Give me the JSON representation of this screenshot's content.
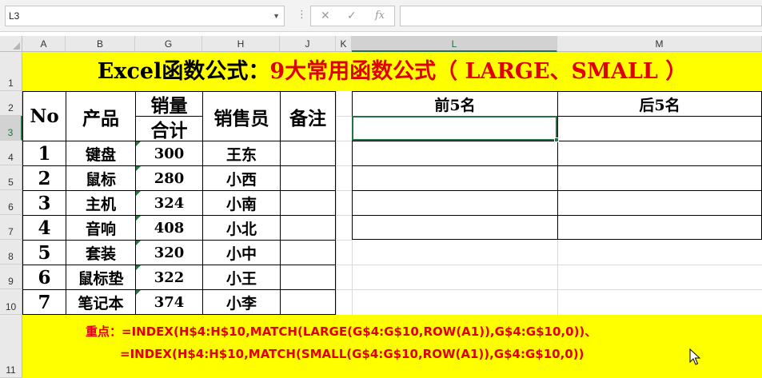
{
  "formula_bar": {
    "name_box": "L3",
    "icons": [
      "more-options-icon",
      "cancel-icon",
      "confirm-icon",
      "insert-function-icon"
    ],
    "fx_label": "fx",
    "formula": ""
  },
  "columns": [
    "A",
    "B",
    "G",
    "H",
    "J",
    "K",
    "L",
    "M"
  ],
  "rows": [
    "1",
    "2",
    "3",
    "4",
    "5",
    "6",
    "7",
    "8",
    "9",
    "10",
    "11"
  ],
  "title": {
    "part1": "Excel函数公式：",
    "part2": "9大常用函数公式（ LARGE、SMALL ）"
  },
  "table": {
    "headers": {
      "no": "No",
      "product": "产品",
      "sales_line1": "销量",
      "sales_line2": "合计",
      "seller": "销售员",
      "remark": "备注"
    },
    "rows": [
      {
        "no": "1",
        "product": "键盘",
        "sales": "300",
        "seller": "王东",
        "remark": ""
      },
      {
        "no": "2",
        "product": "鼠标",
        "sales": "280",
        "seller": "小西",
        "remark": ""
      },
      {
        "no": "3",
        "product": "主机",
        "sales": "324",
        "seller": "小南",
        "remark": ""
      },
      {
        "no": "4",
        "product": "音响",
        "sales": "408",
        "seller": "小北",
        "remark": ""
      },
      {
        "no": "5",
        "product": "套装",
        "sales": "320",
        "seller": "小中",
        "remark": ""
      },
      {
        "no": "6",
        "product": "鼠标垫",
        "sales": "322",
        "seller": "小王",
        "remark": ""
      },
      {
        "no": "7",
        "product": "笔记本",
        "sales": "374",
        "seller": "小李",
        "remark": ""
      }
    ]
  },
  "result": {
    "top_header": "前5名",
    "bottom_header": "后5名"
  },
  "footer": {
    "line1": "重点：=INDEX(H$4:H$10,MATCH(LARGE(G$4:G$10,ROW(A1)),G$4:G$10,0))、",
    "line2": "=INDEX(H$4:H$10,MATCH(SMALL(G$4:G$10,ROW(A1)),G$4:G$10,0))"
  },
  "colors": {
    "highlight": "#ffff00",
    "emphasis_text": "#e00000",
    "selection": "#217346"
  }
}
